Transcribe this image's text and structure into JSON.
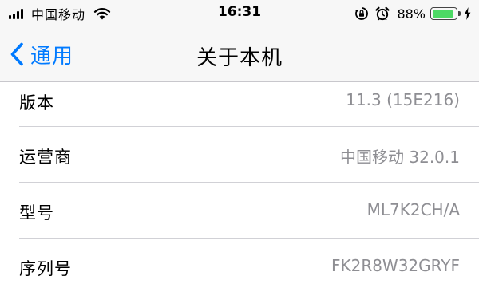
{
  "status_bar": {
    "carrier": "中国移动",
    "time": "16:31",
    "battery_percent": "88%",
    "battery_level": 0.88,
    "icons": [
      "signal-bars-icon",
      "wifi-icon",
      "orientation-lock-icon",
      "alarm-icon",
      "battery-icon",
      "charging-bolt-icon"
    ]
  },
  "nav": {
    "back_label": "通用",
    "title": "关于本机"
  },
  "rows": [
    {
      "label": "版本",
      "value": "11.3 (15E216)"
    },
    {
      "label": "运营商",
      "value": "中国移动 32.0.1"
    },
    {
      "label": "型号",
      "value": "ML7K2CH/A"
    },
    {
      "label": "序列号",
      "value": "FK2R8W32GRYF"
    }
  ],
  "colors": {
    "accent": "#007aff",
    "battery_fill": "#4cd964",
    "secondary_text": "#8e8e93",
    "bar_background": "#f7f7f7"
  }
}
